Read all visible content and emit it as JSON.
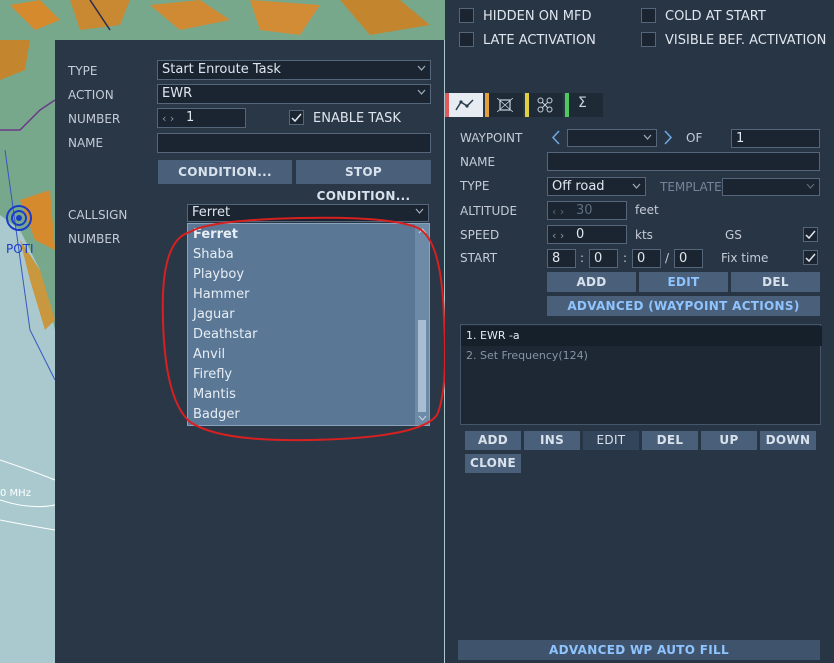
{
  "map": {
    "poti_label": "POTI",
    "freq_label": "0 MHz"
  },
  "flags": {
    "hidden_on_mfd": "HIDDEN ON MFD",
    "cold_at_start": "COLD AT START",
    "late_activation": "LATE ACTIVATION",
    "visible_bef_activation": "VISIBLE BEF. ACTIVATION"
  },
  "task_panel": {
    "type_label": "TYPE",
    "type_value": "Start Enroute Task",
    "action_label": "ACTION",
    "action_value": "EWR",
    "number_label": "NUMBER",
    "number_value": "1",
    "enable_task_label": "ENABLE TASK",
    "name_label": "NAME",
    "name_value": "",
    "condition_button": "CONDITION...",
    "stop_condition_button": "STOP CONDITION...",
    "callsign_label": "CALLSIGN",
    "callsign_value": "Ferret",
    "number2_label": "NUMBER",
    "callsign_options": [
      "Ferret",
      "Shaba",
      "Playboy",
      "Hammer",
      "Jaguar",
      "Deathstar",
      "Anvil",
      "Firefly",
      "Mantis",
      "Badger"
    ]
  },
  "waypoint_panel": {
    "tabs": [
      {
        "icon": "route-icon",
        "color": "#e05a5a"
      },
      {
        "icon": "target-icon",
        "color": "#e0a040"
      },
      {
        "icon": "drone-icon",
        "color": "#e0d040"
      },
      {
        "icon": "sigma-icon",
        "color": "#50c860"
      }
    ],
    "waypoint_label": "WAYPOINT",
    "waypoint_value": "",
    "of_label": "OF",
    "of_value": "1",
    "name_label": "NAME",
    "name_value": "",
    "type_label": "TYPE",
    "type_value": "Off road",
    "template_label": "TEMPLATE",
    "altitude_label": "ALTITUDE",
    "altitude_value": "30",
    "altitude_unit": "feet",
    "speed_label": "SPEED",
    "speed_value": "0",
    "speed_unit": "kts",
    "gs_label": "GS",
    "start_label": "START",
    "start_day": "8",
    "start_h": "0",
    "start_m": "0",
    "start_s": "0",
    "colon": ":",
    "slash": "/",
    "fix_time_label": "Fix time",
    "add_button": "ADD",
    "edit_button": "EDIT",
    "del_button": "DEL",
    "advanced_button": "ADVANCED (WAYPOINT ACTIONS)",
    "actions": [
      "1. EWR -a",
      "2. Set Frequency(124)"
    ],
    "list_buttons": {
      "add": "ADD",
      "ins": "INS",
      "edit": "EDIT",
      "del": "DEL",
      "up": "UP",
      "down": "DOWN",
      "clone": "CLONE"
    },
    "auto_fill_button": "ADVANCED WP AUTO FILL"
  }
}
